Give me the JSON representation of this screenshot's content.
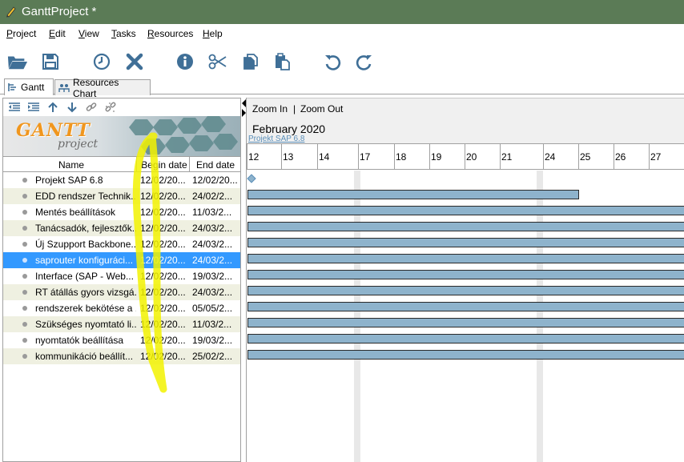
{
  "window": {
    "title": "GanttProject *"
  },
  "menu": [
    "Project",
    "Edit",
    "View",
    "Tasks",
    "Resources",
    "Help"
  ],
  "toolbar": {
    "open": "folder-open-icon",
    "save": "save-icon",
    "history": "clock-icon",
    "delete": "delete-x-icon",
    "properties": "info-icon",
    "cut": "scissors-icon",
    "copy": "copy-icon",
    "paste": "paste-icon",
    "undo": "undo-icon",
    "redo": "redo-icon"
  },
  "tabs": [
    {
      "label": "Gantt",
      "icon": "gantt-icon"
    },
    {
      "label": "Resources Chart",
      "icon": "resources-icon"
    }
  ],
  "tree_toolbar": [
    "outdent-icon",
    "indent-icon",
    "move-up-icon",
    "move-down-icon",
    "link-icon",
    "unlink-icon"
  ],
  "logo": {
    "main": "GANTT",
    "sub": "project"
  },
  "columns": {
    "name": "Name",
    "begin": "Begin date",
    "end": "End date"
  },
  "tasks": [
    {
      "name": "Projekt SAP 6.8",
      "begin": "12/02/20...",
      "end": "12/02/20..."
    },
    {
      "name": "EDD rendszer Technik...",
      "begin": "12/02/20...",
      "end": "24/02/2..."
    },
    {
      "name": "Mentés beállítások",
      "begin": "12/02/20...",
      "end": "11/03/2..."
    },
    {
      "name": "Tanácsadók, fejlesztők...",
      "begin": "12/02/20...",
      "end": "24/03/2..."
    },
    {
      "name": "Új Szupport Backbone...",
      "begin": "12/02/20...",
      "end": "24/03/2..."
    },
    {
      "name": "saprouter konfiguráci...",
      "begin": "12/02/20...",
      "end": "24/03/2..."
    },
    {
      "name": "Interface (SAP - Web...",
      "begin": "12/02/20...",
      "end": "19/03/2..."
    },
    {
      "name": "RT átállás gyors vizsgá...",
      "begin": "12/02/20...",
      "end": "24/03/2..."
    },
    {
      "name": "rendszerek bekötése a ...",
      "begin": "12/02/20...",
      "end": "05/05/2..."
    },
    {
      "name": "Szükséges nyomtató li...",
      "begin": "12/02/20...",
      "end": "11/03/2..."
    },
    {
      "name": "nyomtatók beállítása",
      "begin": "12/02/20...",
      "end": "19/03/2..."
    },
    {
      "name": "kommunikáció beállít...",
      "begin": "12/02/20...",
      "end": "25/02/2..."
    }
  ],
  "selected_task_index": 5,
  "zoom": {
    "in": "Zoom In",
    "sep": "|",
    "out": "Zoom Out"
  },
  "timeline": {
    "month": "February 2020",
    "project_link": "Projekt SAP 6.8",
    "days": [
      "12",
      "13",
      "14",
      "17",
      "18",
      "19",
      "20",
      "21",
      "24",
      "25",
      "26",
      "27"
    ]
  },
  "colors": {
    "titlebar": "#5b7b56",
    "selection": "#3399ff",
    "bar": "#8eb3cc",
    "highlighter": "#f2f200"
  }
}
